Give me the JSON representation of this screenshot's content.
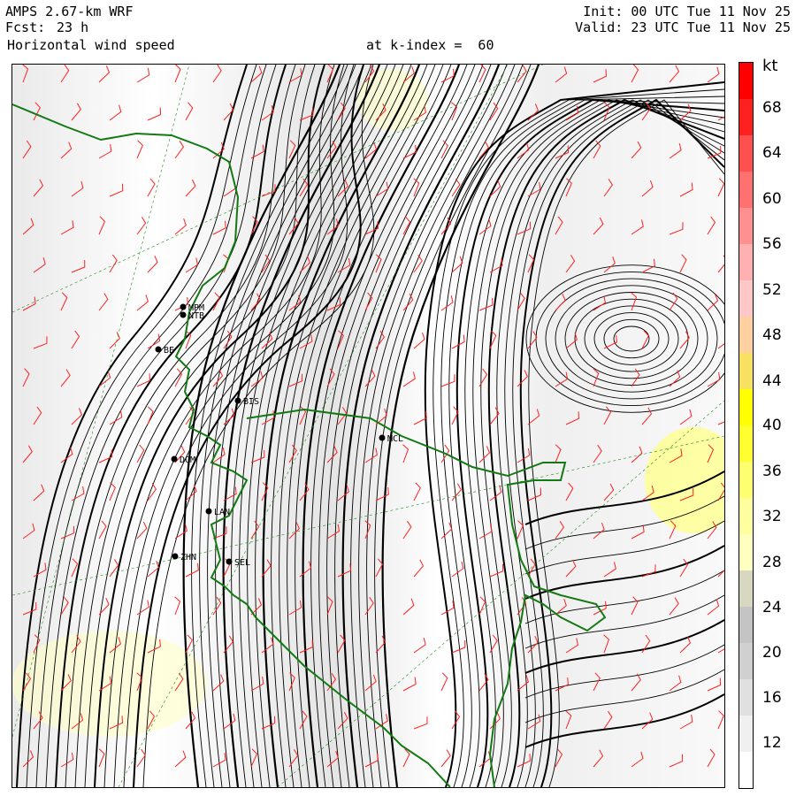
{
  "header": {
    "model": "AMPS 2.67-km WRF",
    "fcst_label": "Fcst:",
    "fcst_value": "23 h",
    "variable": "Horizontal wind speed",
    "level": "at k-index =  60",
    "init": "Init: 00 UTC Tue 11 Nov 25",
    "valid": "Valid: 23 UTC Tue 11 Nov 25"
  },
  "colorbar": {
    "unit": "kt",
    "ticks": [
      "68",
      "64",
      "60",
      "56",
      "52",
      "48",
      "44",
      "40",
      "36",
      "32",
      "28",
      "24",
      "20",
      "16",
      "12"
    ],
    "colors": [
      "#ffffff",
      "#f0f0f0",
      "#e0e0e0",
      "#d0d0d0",
      "#c4c4c4",
      "#d8d8c0",
      "#ffffc0",
      "#ffffa0",
      "#ffff70",
      "#ffff30",
      "#ffff00",
      "#f8e060",
      "#ffd0a0",
      "#ffc8c8",
      "#ffb0b0",
      "#ff9090",
      "#ff7070",
      "#ff5050",
      "#ff2020",
      "#ff0000"
    ]
  },
  "stations": [
    {
      "code": "BIS"
    },
    {
      "code": "MCL"
    },
    {
      "code": "DOM"
    },
    {
      "code": "ZHN"
    },
    {
      "code": "SEL"
    },
    {
      "code": "LAN"
    },
    {
      "code": "NTB"
    },
    {
      "code": "MPM"
    },
    {
      "code": "BE"
    }
  ]
}
